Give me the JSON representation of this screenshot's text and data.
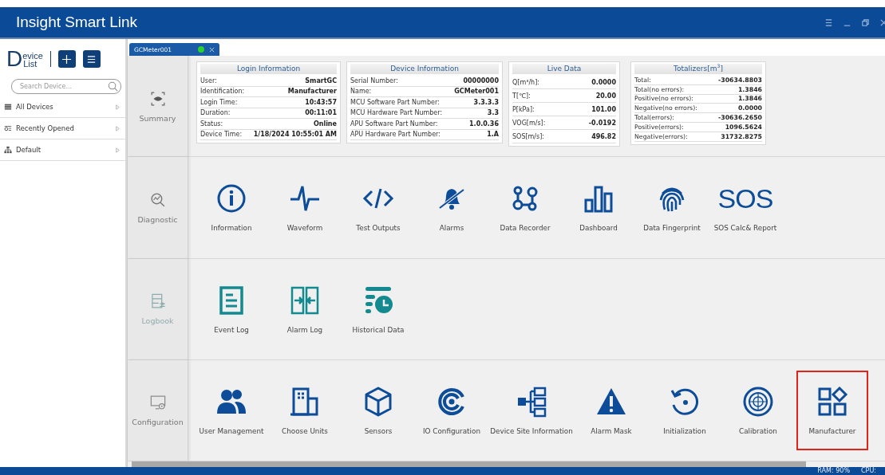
{
  "window": {
    "title": "Insight Smart Link"
  },
  "sidebar": {
    "logo": {
      "initial": "D",
      "line1": "evice",
      "line2": "List"
    },
    "search": {
      "placeholder": "Search Device..."
    },
    "items": [
      {
        "label": "All Devices",
        "expanded": false
      },
      {
        "label": "Recently Opened",
        "expanded": false
      },
      {
        "label": "Default",
        "expanded": false
      }
    ]
  },
  "tabs": [
    {
      "label": "GCMeter001",
      "selected": true,
      "online": true
    }
  ],
  "sections": [
    {
      "kind": "summary",
      "label": "Summary",
      "tables": [
        {
          "title": "Login Information",
          "rows": [
            [
              "User:",
              "SmartGC"
            ],
            [
              "Identification:",
              "Manufacturer"
            ],
            [
              "Login Time:",
              "10:43:57"
            ],
            [
              "Duration:",
              "00:11:01"
            ],
            [
              "Status:",
              "Online"
            ],
            [
              "Device Time:",
              "1/18/2024 10:55:01 AM"
            ]
          ]
        },
        {
          "title": "Device Information",
          "rows": [
            [
              "Serial Number:",
              "00000000"
            ],
            [
              "Name:",
              "GCMeter001"
            ],
            [
              "MCU Software Part Number:",
              "3.3.3.3"
            ],
            [
              "MCU Hardware Part Number:",
              "3.3"
            ],
            [
              "APU Software Part Number:",
              "1.0.0.36"
            ],
            [
              "APU Hardware Part Number:",
              "1.A"
            ]
          ]
        },
        {
          "title": "Live Data",
          "rows": [
            [
              "Q[m³/h]:",
              "0.0000"
            ],
            [
              "T[℃]:",
              "20.00"
            ],
            [
              "P[kPa]:",
              "101.00"
            ],
            [
              "VOG[m/s]:",
              "-0.0192"
            ],
            [
              "SOS[m/s]:",
              "496.82"
            ]
          ]
        },
        {
          "title": "Totalizers[m$^{3}$]",
          "rows": [
            [
              "Total:",
              "-30634.8803"
            ],
            [
              "Total(no errors):",
              "1.3846"
            ],
            [
              "Positive(no errors):",
              "1.3846"
            ],
            [
              "Negative(no errors):",
              "0.0000"
            ],
            [
              "Total(errors):",
              "-30636.2650"
            ],
            [
              "Positive(errors):",
              "1096.5624"
            ],
            [
              "Negative(errors):",
              "31732.8275"
            ]
          ]
        }
      ]
    },
    {
      "kind": "tiles",
      "label": "Diagnostic",
      "tiles": [
        {
          "label": "Information",
          "selected": false
        },
        {
          "label": "Waveform",
          "selected": false
        },
        {
          "label": "Test Outputs",
          "selected": false
        },
        {
          "label": "Alarms",
          "selected": false
        },
        {
          "label": "Data Recorder",
          "selected": false
        },
        {
          "label": "Dashboard",
          "selected": false
        },
        {
          "label": "Data Fingerprint",
          "selected": false
        },
        {
          "label": "SOS Calc& Report",
          "selected": false,
          "icon_text": "SOS"
        }
      ]
    },
    {
      "kind": "tiles",
      "label": "Logbook",
      "tiles": [
        {
          "label": "Event Log",
          "selected": false
        },
        {
          "label": "Alarm Log",
          "selected": false
        },
        {
          "label": "Historical Data",
          "selected": false
        }
      ]
    },
    {
      "kind": "tiles",
      "label": "Configuration",
      "tiles": [
        {
          "label": "User Management",
          "selected": false
        },
        {
          "label": "Choose Units",
          "selected": false
        },
        {
          "label": "Sensors",
          "selected": false
        },
        {
          "label": "IO Configuration",
          "selected": false
        },
        {
          "label": "Device Site Information",
          "selected": false
        },
        {
          "label": "Alarm Mask",
          "selected": false
        },
        {
          "label": "Initialization",
          "selected": false
        },
        {
          "label": "Calibration",
          "selected": false
        },
        {
          "label": "Manufacturer",
          "selected": true
        }
      ]
    }
  ],
  "status_bar": {
    "ram": "RAM: 90%",
    "cpu": "CPU:"
  }
}
